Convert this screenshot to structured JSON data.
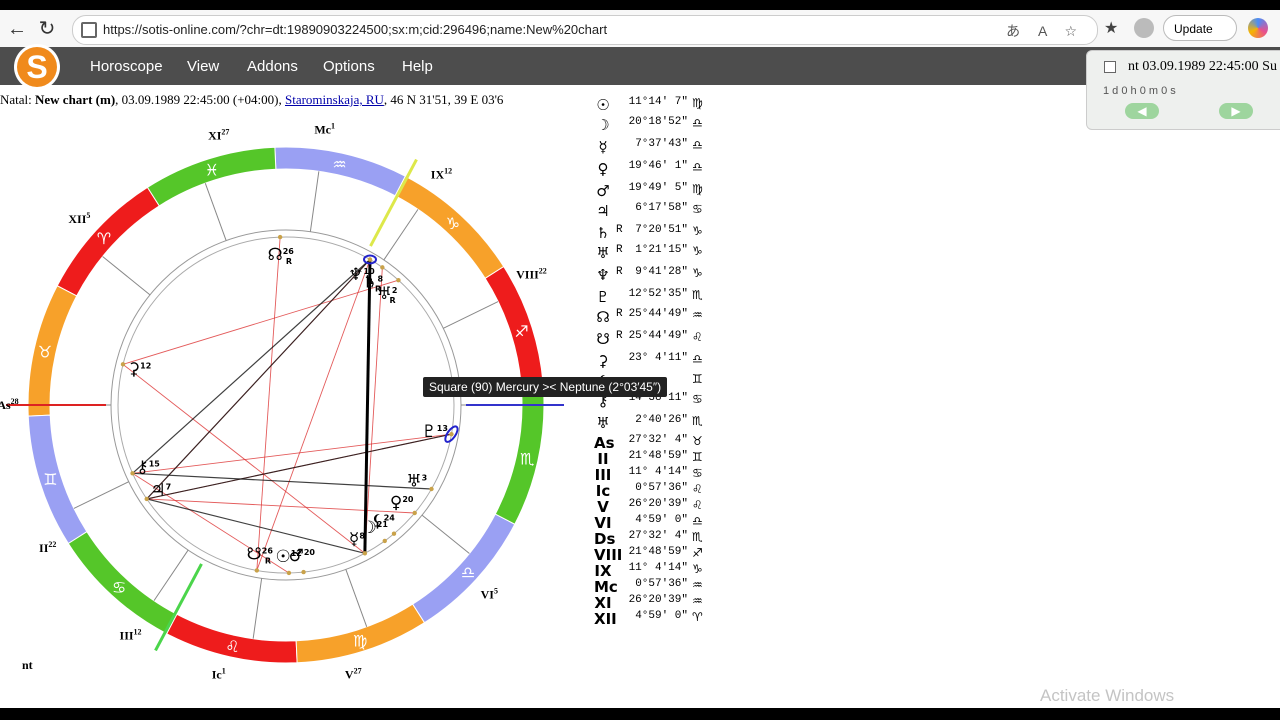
{
  "browser": {
    "back": "←",
    "reload": "↻",
    "url": "https://sotis-online.com/?chr=dt:19890903224500;sx:m;cid:296496;name:New%20chart",
    "update_label": "Update",
    "more": "···"
  },
  "app": {
    "logo_letter": "S",
    "menu": [
      "Horoscope",
      "View",
      "Addons",
      "Options",
      "Help"
    ]
  },
  "natal": {
    "prefix": "Natal:",
    "name": "New chart (m)",
    "datetime": ", 03.09.1989 22:45:00 (+04:00),",
    "place": "Starominskaja, RU",
    "coords": ", 46 N 31'51, 39 E 03'6"
  },
  "side_panel": {
    "title": "nt 03.09.1989 22:45:00 Su",
    "step": "1 d  0 h  0 m  0 s",
    "prev": "◀",
    "next": "▶"
  },
  "positions": [
    {
      "sym": "☉",
      "r": "",
      "deg": "11°14′ 7″",
      "sign": "♍"
    },
    {
      "sym": "☽",
      "r": "",
      "deg": "20°18′52″",
      "sign": "♎"
    },
    {
      "sym": "☿",
      "r": "",
      "deg": "7°37′43″",
      "sign": "♎"
    },
    {
      "sym": "♀",
      "r": "",
      "deg": "19°46′ 1″",
      "sign": "♎"
    },
    {
      "sym": "♂",
      "r": "",
      "deg": "19°49′ 5″",
      "sign": "♍"
    },
    {
      "sym": "♃",
      "r": "",
      "deg": "6°17′58″",
      "sign": "♋"
    },
    {
      "sym": "♄",
      "r": "R",
      "deg": "7°20′51″",
      "sign": "♑"
    },
    {
      "sym": "♅",
      "r": "R",
      "deg": "1°21′15″",
      "sign": "♑"
    },
    {
      "sym": "♆",
      "r": "R",
      "deg": "9°41′28″",
      "sign": "♑"
    },
    {
      "sym": "♇",
      "r": "",
      "deg": "12°52′35″",
      "sign": "♏"
    },
    {
      "sym": "☊",
      "r": "R",
      "deg": "25°44′49″",
      "sign": "♒"
    },
    {
      "sym": "☋",
      "r": "R",
      "deg": "25°44′49″",
      "sign": "♌"
    },
    {
      "sym": "⚳",
      "r": "",
      "deg": "23° 4′11″",
      "sign": "♎"
    },
    {
      "sym": "⚸",
      "r": "",
      "deg": "",
      "sign": "♊"
    },
    {
      "sym": "⚷",
      "r": "",
      "deg": "14°38′11″",
      "sign": "♋"
    },
    {
      "sym": "♅",
      "r": "",
      "deg": "2°40′26″",
      "sign": "♏"
    },
    {
      "sym": "As",
      "r": "",
      "deg": "27°32′ 4″",
      "sign": "♉"
    },
    {
      "sym": "II",
      "r": "",
      "deg": "21°48′59″",
      "sign": "♊"
    },
    {
      "sym": "III",
      "r": "",
      "deg": "11° 4′14″",
      "sign": "♋"
    },
    {
      "sym": "Ic",
      "r": "",
      "deg": "0°57′36″",
      "sign": "♌"
    },
    {
      "sym": "V",
      "r": "",
      "deg": "26°20′39″",
      "sign": "♌"
    },
    {
      "sym": "VI",
      "r": "",
      "deg": "4°59′ 0″",
      "sign": "♎"
    },
    {
      "sym": "Ds",
      "r": "",
      "deg": "27°32′ 4″",
      "sign": "♏"
    },
    {
      "sym": "VIII",
      "r": "",
      "deg": "21°48′59″",
      "sign": "♐"
    },
    {
      "sym": "IX",
      "r": "",
      "deg": "11° 4′14″",
      "sign": "♑"
    },
    {
      "sym": "Mc",
      "r": "",
      "deg": "0°57′36″",
      "sign": "♒"
    },
    {
      "sym": "XI",
      "r": "",
      "deg": "26°20′39″",
      "sign": "♒"
    },
    {
      "sym": "XII",
      "r": "",
      "deg": "4°59′ 0″",
      "sign": "♈"
    }
  ],
  "tooltip": "Square (90) Mercury >< Neptune (2°03′45″)",
  "wheel": {
    "signs": [
      "♈",
      "♉",
      "♊",
      "♋",
      "♌",
      "♍",
      "♎",
      "♏",
      "♐",
      "♑",
      "♒",
      "♓"
    ],
    "sign_colors": [
      "#ee1c1c",
      "#f7a12a",
      "#9aa0f3",
      "#55c629",
      "#ee1c1c",
      "#f7a12a",
      "#9aa0f3",
      "#55c629",
      "#ee1c1c",
      "#f7a12a",
      "#9aa0f3",
      "#55c629"
    ],
    "house_labels": [
      {
        "text": "As",
        "deg": "28"
      },
      {
        "text": "II",
        "deg": "22"
      },
      {
        "text": "III",
        "deg": "12"
      },
      {
        "text": "Ic",
        "deg": "1"
      },
      {
        "text": "V",
        "deg": "27"
      },
      {
        "text": "VI",
        "deg": "5"
      },
      {
        "text": "VIII",
        "deg": "22"
      },
      {
        "text": "IX",
        "deg": "12"
      },
      {
        "text": "Mc",
        "deg": "1"
      },
      {
        "text": "XI",
        "deg": "27"
      },
      {
        "text": "XII",
        "deg": "5"
      }
    ],
    "planet_labels": [
      {
        "sym": "☊",
        "deg": "26",
        "r": "R"
      },
      {
        "sym": "♆",
        "deg": "10",
        "r": "R"
      },
      {
        "sym": "♄",
        "deg": "8",
        "r": "R"
      },
      {
        "sym": "♅",
        "deg": "2",
        "r": "R"
      },
      {
        "sym": "♇",
        "deg": "13",
        "r": ""
      },
      {
        "sym": "♅",
        "deg": "3",
        "r": ""
      },
      {
        "sym": "♀",
        "deg": "20",
        "r": ""
      },
      {
        "sym": "☽",
        "deg": "21",
        "r": ""
      },
      {
        "sym": "☿",
        "deg": "8",
        "r": ""
      },
      {
        "sym": "☉",
        "deg": "12",
        "r": ""
      },
      {
        "sym": "♂",
        "deg": "20",
        "r": ""
      },
      {
        "sym": "☋",
        "deg": "26",
        "r": "R"
      },
      {
        "sym": "♃",
        "deg": "7",
        "r": ""
      },
      {
        "sym": "⚷",
        "deg": "15",
        "r": ""
      },
      {
        "sym": "⚳",
        "deg": "12",
        "r": ""
      },
      {
        "sym": "⚸",
        "deg": "24",
        "r": ""
      }
    ]
  },
  "chart_footer": "nt",
  "watermark": "Activate Windows"
}
